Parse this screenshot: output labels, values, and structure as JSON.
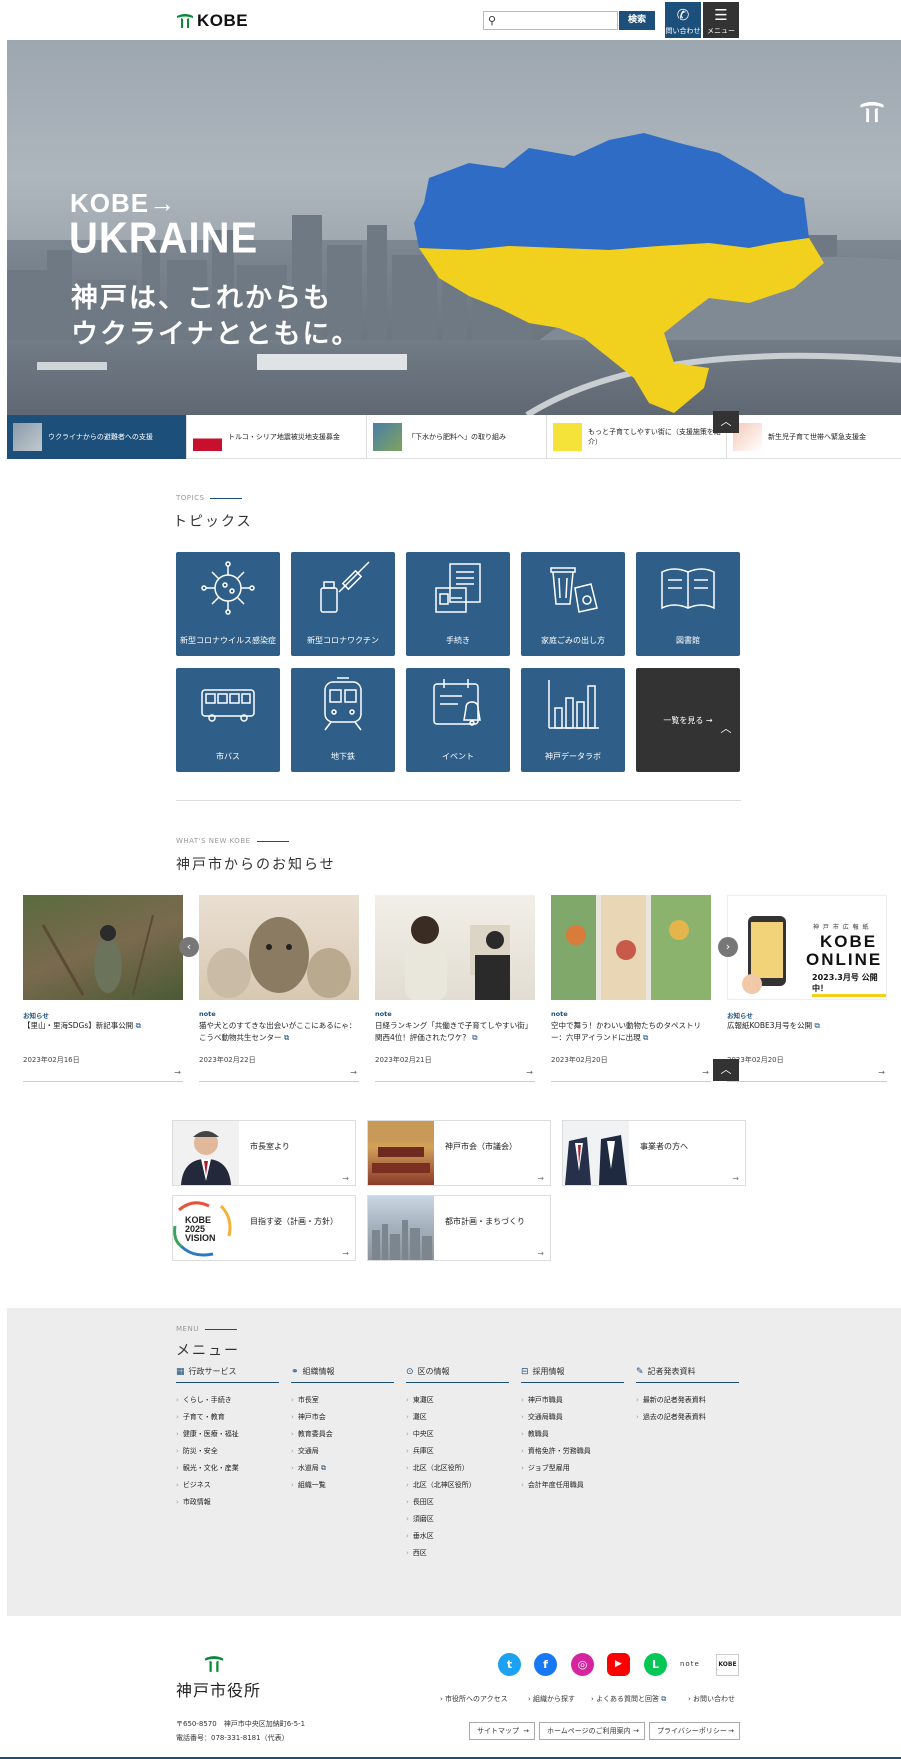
{
  "header": {
    "logo_text": "KOBE",
    "search_placeholder": "",
    "search_button": "検索",
    "contact_label": "問い合わせ",
    "menu_label": "メニュー"
  },
  "hero": {
    "kobe": "KOBE→",
    "ukraine": "UKRAINE",
    "line1": "神戸は、これからも",
    "line2": "ウクライナとともに。",
    "flag_colors": [
      "#2f6cc5",
      "#f2d11e"
    ]
  },
  "slider": [
    {
      "label": "ウクライナからの避難者への支援"
    },
    {
      "label": "トルコ・シリア地震被災地支援募金"
    },
    {
      "label": "「下水から肥料へ」の取り組み"
    },
    {
      "label": "もっと子育てしやすい街に（支援施策を紹介）"
    },
    {
      "label": "新生児子育て世帯へ緊急支援金"
    }
  ],
  "topics": {
    "en": "TOPICS",
    "jp": "トピックス",
    "tiles": [
      {
        "label": "新型コロナウイルス感染症",
        "icon": "virus-icon"
      },
      {
        "label": "新型コロナワクチン",
        "icon": "vaccine-icon"
      },
      {
        "label": "手続き",
        "icon": "document-icon"
      },
      {
        "label": "家庭ごみの出し方",
        "icon": "trash-icon"
      },
      {
        "label": "図書館",
        "icon": "book-icon"
      },
      {
        "label": "市バス",
        "icon": "bus-icon"
      },
      {
        "label": "地下鉄",
        "icon": "train-icon"
      },
      {
        "label": "イベント",
        "icon": "calendar-bell-icon"
      },
      {
        "label": "神戸データラボ",
        "icon": "bar-chart-icon"
      },
      {
        "label": "一覧を見る",
        "icon": "arrow-right-icon"
      }
    ]
  },
  "news": {
    "en": "WHAT'S NEW KOBE",
    "jp": "神戸市からのお知らせ",
    "items": [
      {
        "category": "お知らせ",
        "title": "【里山・里海SDGs】新記事公開",
        "date": "2023年02月16日"
      },
      {
        "category": "note",
        "title": "猫や犬とのすてきな出会いがここにあるにゃ：こうべ動物共生センター",
        "date": "2023年02月22日"
      },
      {
        "category": "note",
        "title": "日経ランキング「共働きで子育てしやすい街」関西4位！評価されたワケ？",
        "date": "2023年02月21日"
      },
      {
        "category": "note",
        "title": "空中で舞う！かわいい動物たちのタペストリー：六甲アイランドに出現",
        "date": "2023年02月20日"
      },
      {
        "category": "お知らせ",
        "title": "広報紙KOBE3月号を公開",
        "date": "2023年02月20日"
      }
    ],
    "online_banner": {
      "title1": "神 戸 市 広 報 紙",
      "title2": "KOBE",
      "title3": "ONLINE",
      "tag": "2023.3月号 公開中！"
    }
  },
  "links": [
    {
      "label": "市長室より"
    },
    {
      "label": "神戸市会（市議会）"
    },
    {
      "label": "事業者の方へ"
    },
    {
      "label": "目指す姿（計画・方針）"
    },
    {
      "label": "都市計画・まちづくり"
    }
  ],
  "vision_text": [
    "KOBE",
    "2025",
    "VISION"
  ],
  "menu": {
    "en": "MENU",
    "jp": "メニュー",
    "cols": [
      {
        "title": "行政サービス",
        "icon": "building-icon",
        "items": [
          "くらし・手続き",
          "子育て・教育",
          "健康・医療・福祉",
          "防災・安全",
          "観光・文化・産業",
          "ビジネス",
          "市政情報"
        ]
      },
      {
        "title": "組織情報",
        "icon": "org-chart-icon",
        "items": [
          "市長室",
          "神戸市会",
          "教育委員会",
          "交通局",
          "水道局",
          "組織一覧"
        ]
      },
      {
        "title": "区の情報",
        "icon": "map-pin-icon",
        "items": [
          "東灘区",
          "灘区",
          "中央区",
          "兵庫区",
          "北区（北区役所）",
          "北区（北神区役所）",
          "長田区",
          "須磨区",
          "垂水区",
          "西区"
        ]
      },
      {
        "title": "採用情報",
        "icon": "briefcase-icon",
        "items": [
          "神戸市職員",
          "交通局職員",
          "教職員",
          "資格免許・労務職員",
          "ジョブ型雇用",
          "会計年度任用職員"
        ]
      },
      {
        "title": "記者発表資料",
        "icon": "pen-icon",
        "items": [
          "最新の記者発表資料",
          "過去の記者発表資料"
        ]
      }
    ]
  },
  "footer": {
    "org": "神戸市役所",
    "address": "〒650-8570　神戸市中央区加納町6-5-1",
    "phone": "電話番号：078-331-8181（代表）",
    "links": [
      "市役所へのアクセス",
      "組織から探す",
      "よくある質問と回答",
      "お問い合わせ"
    ],
    "buttons": [
      "サイトマップ",
      "ホームページのご利用案内",
      "プライバシーポリシー"
    ],
    "sns": [
      {
        "name": "twitter-icon",
        "color": "#1da1f2",
        "glyph": "t"
      },
      {
        "name": "facebook-icon",
        "color": "#1877f2",
        "glyph": "f"
      },
      {
        "name": "instagram-icon",
        "color": "#d6249f",
        "glyph": "◎"
      },
      {
        "name": "youtube-icon",
        "color": "#ff0000",
        "glyph": "▶"
      },
      {
        "name": "line-icon",
        "color": "#06c755",
        "glyph": "L"
      }
    ],
    "note_label": "note",
    "kobe_small": "KOBE"
  },
  "colors": {
    "primary": "#1d4f7b",
    "tile": "#2f5f88",
    "dark": "#333333"
  }
}
